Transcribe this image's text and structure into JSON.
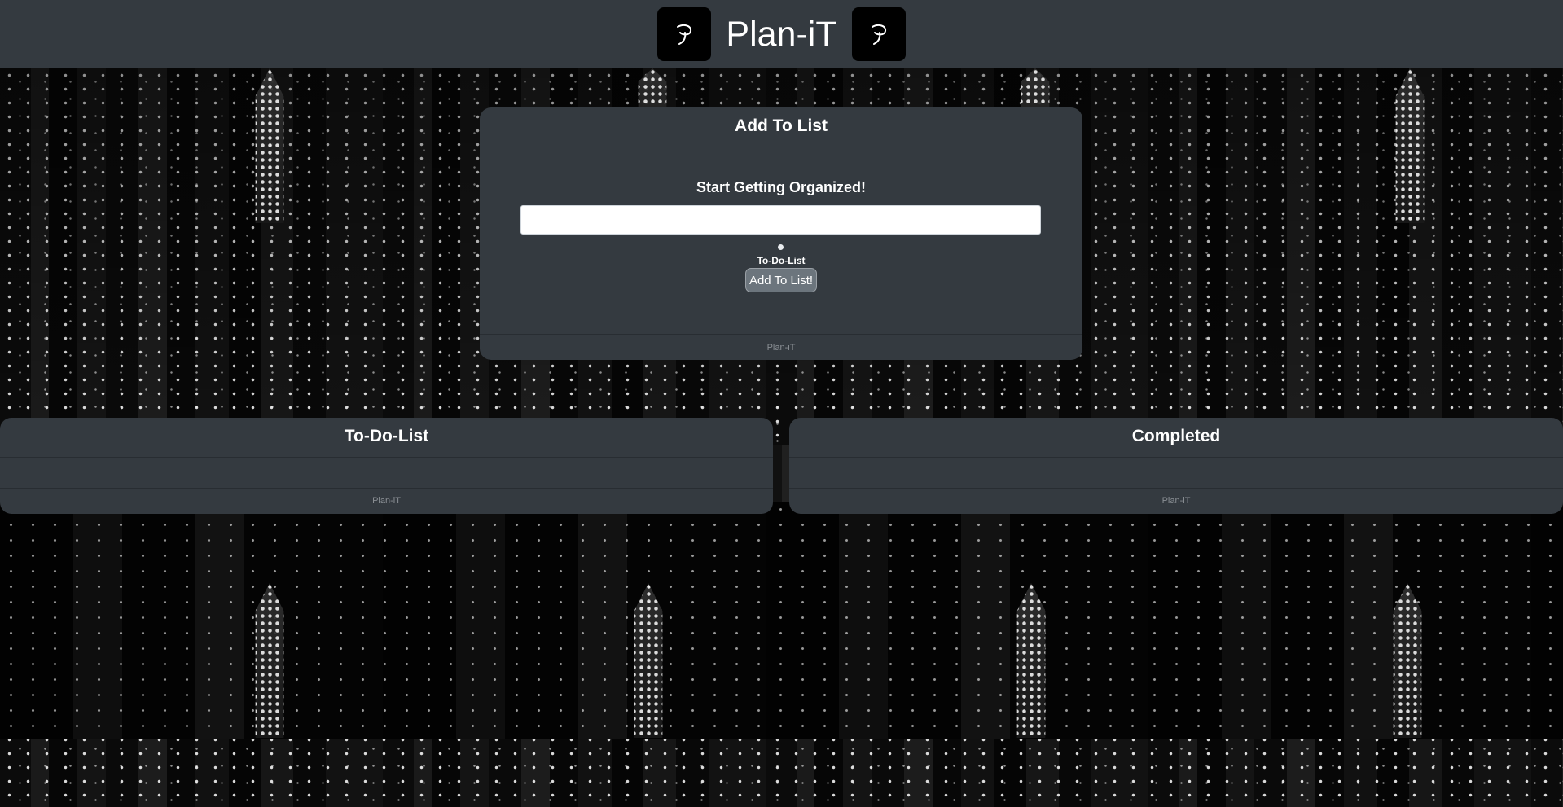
{
  "header": {
    "brand": "Plan-iT",
    "logo_icon": "p-swirl-icon"
  },
  "add_card": {
    "title": "Add To List",
    "prompt": "Start Getting Organized!",
    "input_value": "",
    "input_placeholder": "",
    "radio_label": "To-Do-List",
    "button_label": "Add To List!",
    "footer": "Plan-iT"
  },
  "todo_card": {
    "title": "To-Do-List",
    "items": [],
    "footer": "Plan-iT"
  },
  "done_card": {
    "title": "Completed",
    "items": [],
    "footer": "Plan-iT"
  },
  "colors": {
    "panel": "#343a40",
    "button": "#6c757d"
  }
}
